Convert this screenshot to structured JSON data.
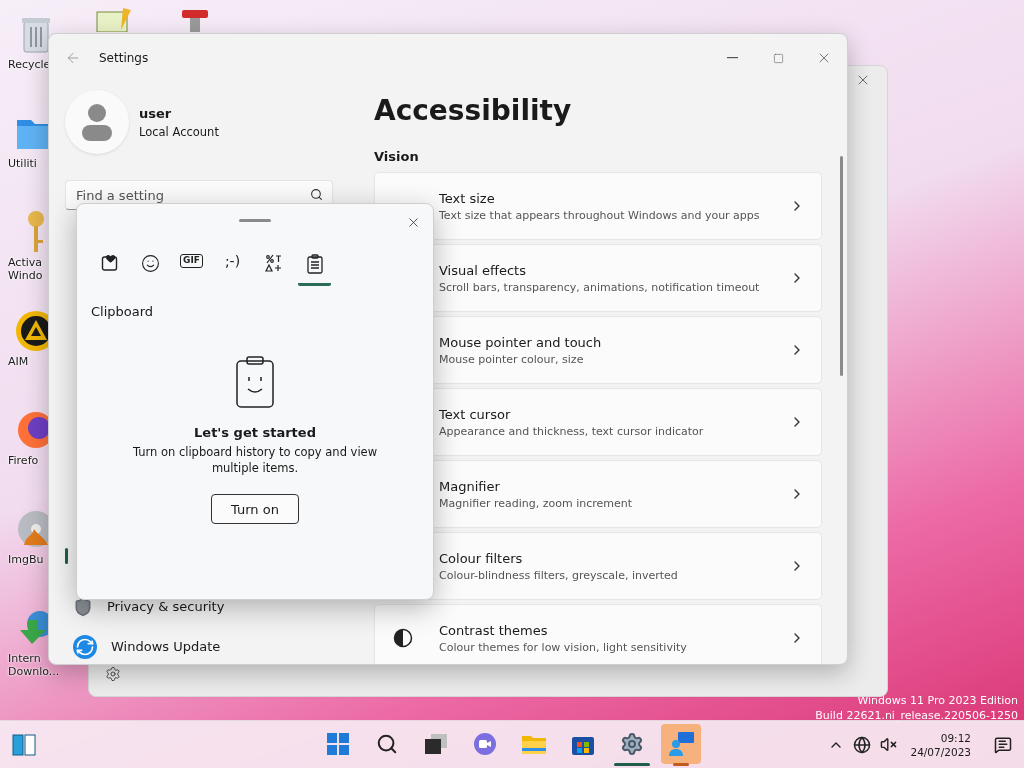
{
  "desktop": {
    "top_icons": [
      {
        "kind": "notepad"
      },
      {
        "kind": "tool"
      }
    ],
    "icons": [
      {
        "kind": "recycle",
        "lines": [
          "Recycle"
        ]
      },
      {
        "kind": "folder",
        "lines": [
          "Utiliti"
        ]
      },
      {
        "kind": "key",
        "lines": [
          "Activa",
          "Windo"
        ]
      },
      {
        "kind": "aim",
        "lines": [
          "AIM"
        ]
      },
      {
        "kind": "firefox",
        "lines": [
          "Firefo"
        ]
      },
      {
        "kind": "disc",
        "lines": [
          "ImgBu"
        ]
      },
      {
        "kind": "download",
        "lines": [
          "Intern",
          "Downlo..."
        ]
      }
    ],
    "watermark": [
      "Windows 11 Pro 2023 Edition",
      "Build 22621.ni_release.220506-1250"
    ]
  },
  "settings": {
    "title": "Settings",
    "user": {
      "name": "user",
      "account": "Local Account"
    },
    "search": {
      "placeholder": "Find a setting"
    },
    "nav": [
      {
        "kind": "privacy",
        "label": "Privacy & security"
      },
      {
        "kind": "update",
        "label": "Windows Update"
      }
    ],
    "heading": "Accessibility",
    "section": "Vision",
    "items": [
      {
        "title": "Text size",
        "subtitle": "Text size that appears throughout Windows and your apps"
      },
      {
        "title": "Visual effects",
        "subtitle": "Scroll bars, transparency, animations, notification timeout"
      },
      {
        "title": "Mouse pointer and touch",
        "subtitle": "Mouse pointer colour, size"
      },
      {
        "title": "Text cursor",
        "subtitle": "Appearance and thickness, text cursor indicator"
      },
      {
        "title": "Magnifier",
        "subtitle": "Magnifier reading, zoom increment"
      },
      {
        "title": "Colour filters",
        "subtitle": "Colour-blindness filters, greyscale, inverted"
      },
      {
        "title": "Contrast themes",
        "subtitle": "Colour themes for low vision, light sensitivity"
      }
    ]
  },
  "clipboard_panel": {
    "tabs": [
      {
        "kind": "favorites",
        "selected": false
      },
      {
        "kind": "emoji",
        "selected": false
      },
      {
        "kind": "gif",
        "label": "GIF",
        "selected": false
      },
      {
        "kind": "kaomoji",
        "label": ";-)",
        "selected": false
      },
      {
        "kind": "symbols",
        "selected": false
      },
      {
        "kind": "clipboard",
        "selected": true
      }
    ],
    "title": "Clipboard",
    "empty": {
      "heading": "Let's get started",
      "text": "Turn on clipboard history to copy and view multiple items.",
      "button": "Turn on"
    }
  },
  "taskbar": {
    "apps": [
      {
        "kind": "start",
        "running": false,
        "selected": false
      },
      {
        "kind": "search",
        "running": false,
        "selected": false
      },
      {
        "kind": "taskview",
        "running": false,
        "selected": false
      },
      {
        "kind": "chat",
        "running": false,
        "selected": false
      },
      {
        "kind": "explorer",
        "running": false,
        "selected": false
      },
      {
        "kind": "store",
        "running": false,
        "selected": false
      },
      {
        "kind": "settings",
        "running": true,
        "selected": false
      },
      {
        "kind": "remote",
        "running": false,
        "selected": true
      }
    ],
    "clock": {
      "time": "09:12",
      "date": "24/07/2023"
    }
  }
}
